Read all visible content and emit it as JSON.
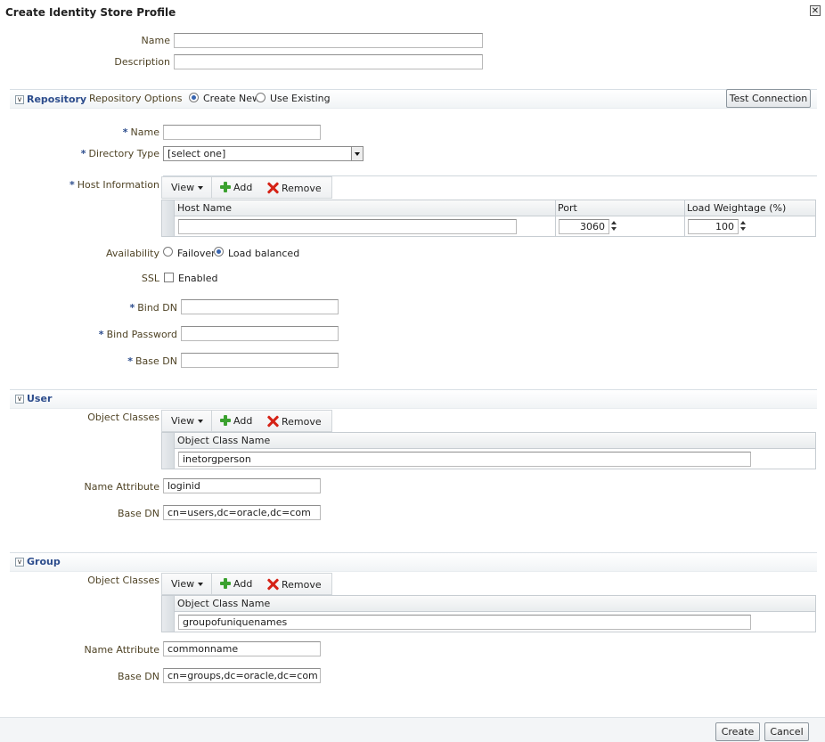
{
  "dialog": {
    "title": "Create Identity Store Profile",
    "close_icon": "close-icon"
  },
  "profile": {
    "name_label": "Name",
    "name_value": "",
    "description_label": "Description",
    "description_value": ""
  },
  "repository": {
    "section_title": "Repository",
    "options_label": "Repository Options",
    "option_create_new": "Create New",
    "option_use_existing": "Use Existing",
    "selected_option": "Create New",
    "test_connection": "Test Connection",
    "name_label": "Name",
    "name_value": "",
    "directory_type_label": "Directory Type",
    "directory_type_value": "[select one]",
    "host_info_label": "Host Information",
    "toolbar": {
      "view": "View",
      "add": "Add",
      "remove": "Remove"
    },
    "host_table": {
      "columns": [
        "Host Name",
        "Port",
        "Load Weightage (%)"
      ],
      "rows": [
        {
          "host_name": "",
          "port": "3060",
          "load": "100"
        }
      ]
    },
    "availability_label": "Availability",
    "availability_failover": "Failover",
    "availability_load_balanced": "Load balanced",
    "availability_selected": "Load balanced",
    "ssl_label": "SSL",
    "ssl_enabled_label": "Enabled",
    "ssl_enabled": false,
    "bind_dn_label": "Bind DN",
    "bind_dn_value": "",
    "bind_password_label": "Bind Password",
    "bind_password_value": "",
    "base_dn_label": "Base DN",
    "base_dn_value": ""
  },
  "user": {
    "section_title": "User",
    "object_classes_label": "Object Classes",
    "toolbar": {
      "view": "View",
      "add": "Add",
      "remove": "Remove"
    },
    "table": {
      "column": "Object Class Name",
      "rows": [
        "inetorgperson"
      ]
    },
    "name_attribute_label": "Name Attribute",
    "name_attribute_value": "loginid",
    "base_dn_label": "Base DN",
    "base_dn_value": "cn=users,dc=oracle,dc=com"
  },
  "group": {
    "section_title": "Group",
    "object_classes_label": "Object Classes",
    "toolbar": {
      "view": "View",
      "add": "Add",
      "remove": "Remove"
    },
    "table": {
      "column": "Object Class Name",
      "rows": [
        "groupofuniquenames"
      ]
    },
    "name_attribute_label": "Name Attribute",
    "name_attribute_value": "commonname",
    "base_dn_label": "Base DN",
    "base_dn_value": "cn=groups,dc=oracle,dc=com"
  },
  "footer": {
    "create": "Create",
    "cancel": "Cancel"
  },
  "required_marker": "*"
}
